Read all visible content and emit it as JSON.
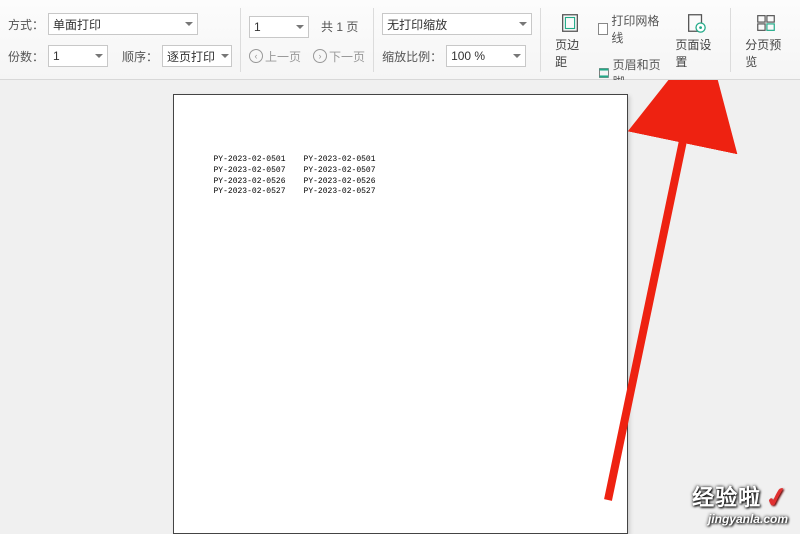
{
  "toolbar": {
    "mode_label": "方式：",
    "mode_value": "单面打印",
    "copies_label": "份数：",
    "copies_value": "1",
    "order_label": "顺序：",
    "order_value": "逐页打印",
    "page_select_value": "1",
    "page_total_text": "共 1 页",
    "prev_page": "上一页",
    "next_page": "下一页",
    "scale_select": "无打印缩放",
    "scale_ratio_label": "缩放比例：",
    "scale_ratio_value": "100 %",
    "margins_label": "页边距",
    "gridlines_label": "打印网格线",
    "headerfooter_label": "页眉和页脚",
    "page_setup_label": "页面设置",
    "page_break_label": "分页预览"
  },
  "page": {
    "col1": [
      "PY-2023-02-0501",
      "PY-2023-02-0507",
      "PY-2023-02-0526",
      "PY-2023-02-0527"
    ],
    "col2": [
      "PY-2023-02-0501",
      "PY-2023-02-0507",
      "PY-2023-02-0526",
      "PY-2023-02-0527"
    ]
  },
  "watermark": {
    "title": "经验啦",
    "url": "jingyanla.com"
  }
}
